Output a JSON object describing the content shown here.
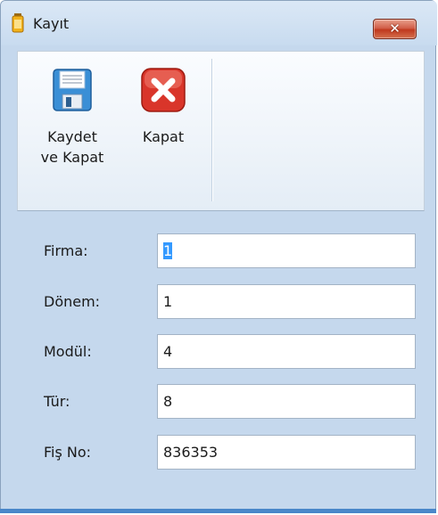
{
  "window": {
    "title": "Kayıt",
    "close_glyph": "✕"
  },
  "ribbon": {
    "save": {
      "label_line1": "Kaydet",
      "label_line2": "ve Kapat",
      "icon": "floppy-disk-icon"
    },
    "close": {
      "label": "Kapat",
      "icon": "red-x-icon"
    }
  },
  "form": {
    "rows": [
      {
        "label": "Firma:",
        "value": "1",
        "selected": true
      },
      {
        "label": "Dönem:",
        "value": "1"
      },
      {
        "label": "Modül:",
        "value": "4"
      },
      {
        "label": "Tür:",
        "value": "8"
      },
      {
        "label": "Fiş No:",
        "value": "836353"
      }
    ]
  },
  "colors": {
    "accent": "#3399ff",
    "close_red": "#c0391e",
    "frame": "#c5d8ed"
  }
}
